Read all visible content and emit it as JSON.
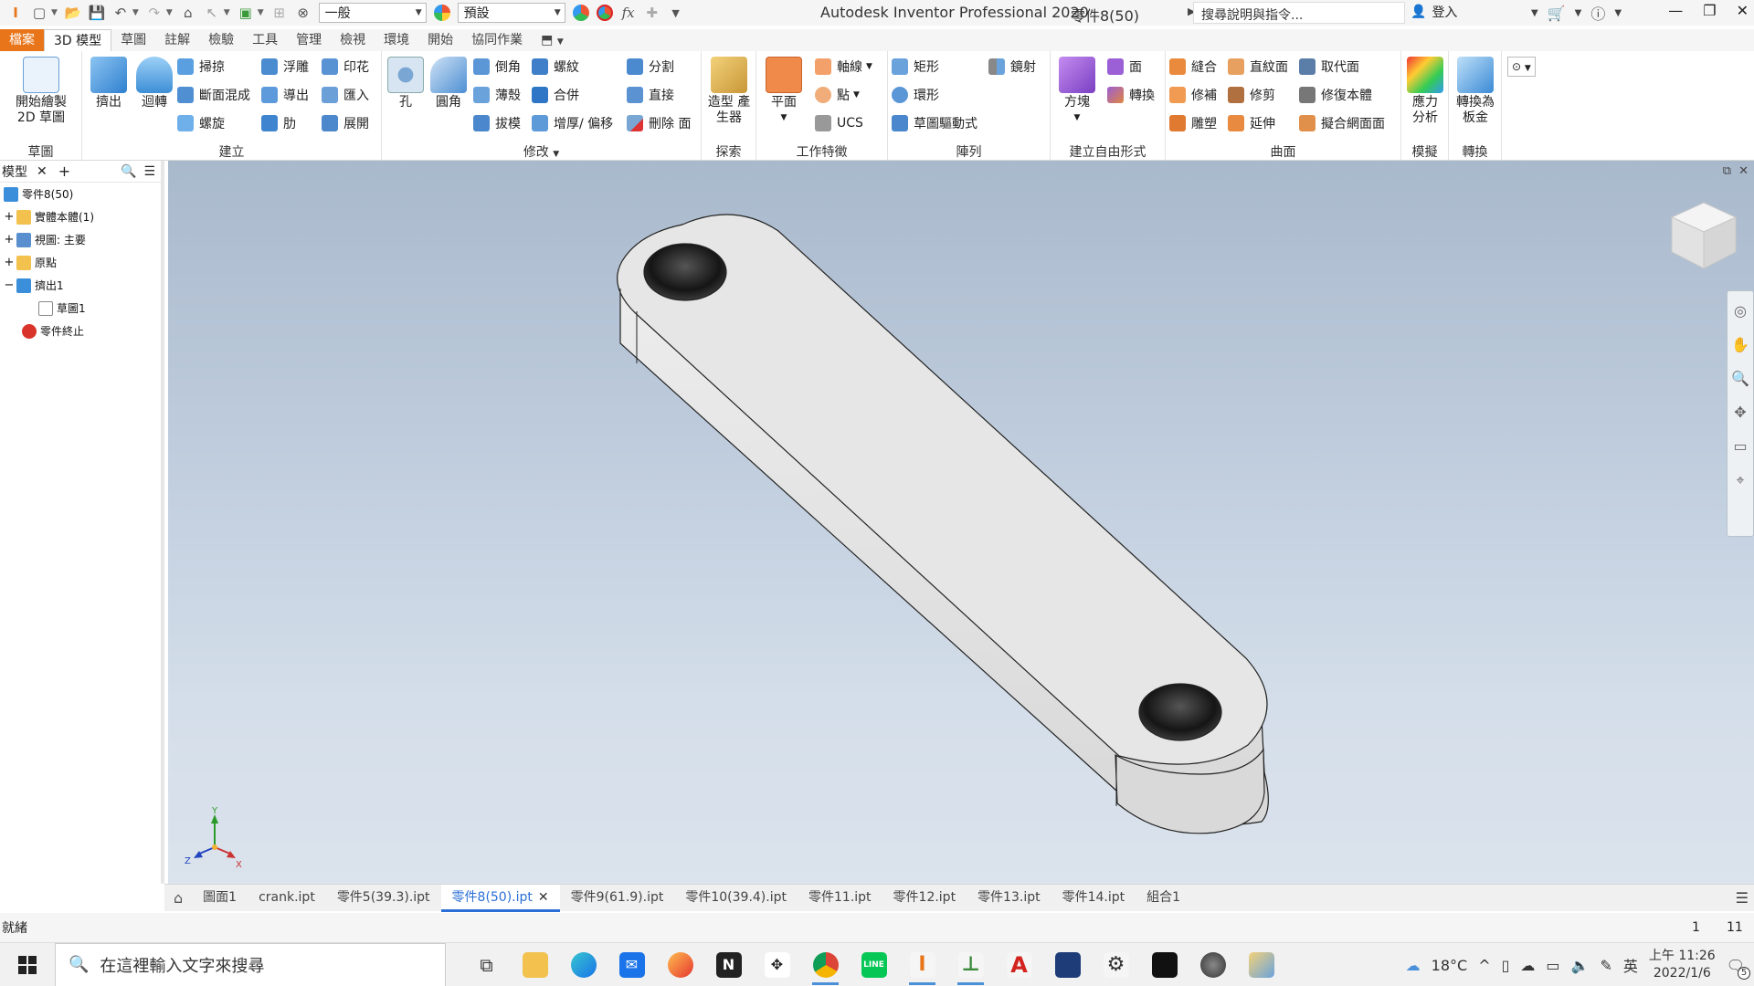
{
  "app": {
    "title": "Autodesk Inventor Professional 2020",
    "document": "零件8(50)",
    "help_search_placeholder": "搜尋說明與指令...",
    "sign_in": "登入"
  },
  "quick_access": {
    "material": "一般",
    "appearance": "預設"
  },
  "tabs": [
    "檔案",
    "3D 模型",
    "草圖",
    "註解",
    "檢驗",
    "工具",
    "管理",
    "檢視",
    "環境",
    "開始",
    "協同作業"
  ],
  "ribbon": {
    "sketch": {
      "start_2d_sketch": "開始繪製 2D 草圖",
      "panel": "草圖"
    },
    "create": {
      "extrude": "擠出",
      "revolve": "迴轉",
      "sweep": "掃掠",
      "loft": "斷面混成",
      "coil": "螺旋",
      "emboss": "浮雕",
      "derive": "導出",
      "rib": "肋",
      "decal": "印花",
      "import": "匯入",
      "unwrap": "展開",
      "panel": "建立"
    },
    "modify": {
      "hole": "孔",
      "fillet": "圓角",
      "chamfer": "倒角",
      "shell": "薄殼",
      "draft": "拔模",
      "thread": "螺紋",
      "combine": "合併",
      "thicken": "增厚/ 偏移",
      "split": "分割",
      "direct": "直接",
      "delete_face": "刪除 面",
      "panel": "修改"
    },
    "explore": {
      "shape_generator": "造型 產生器",
      "panel": "探索"
    },
    "work_features": {
      "plane": "平面",
      "axis": "軸線",
      "point": "點",
      "ucs": "UCS",
      "panel": "工作特徵"
    },
    "pattern": {
      "rectangular": "矩形",
      "circular": "環形",
      "sketch_driven": "草圖驅動式",
      "mirror": "鏡射",
      "panel": "陣列"
    },
    "freeform": {
      "box": "方塊",
      "face": "面",
      "convert": "轉換",
      "panel": "建立自由形式"
    },
    "surface": {
      "stitch": "縫合",
      "patch": "修補",
      "sculpt": "雕塑",
      "ruled_surface": "直紋面",
      "trim": "修剪",
      "extend": "延伸",
      "replace_face": "取代面",
      "repair_bodies": "修復本體",
      "fit_mesh_face": "擬合網面面",
      "panel": "曲面"
    },
    "simulation": {
      "stress_analysis": "應力 分析",
      "panel": "模擬"
    },
    "convert": {
      "to_sheet_metal": "轉換為 板金",
      "panel": "轉換"
    }
  },
  "browser": {
    "tab": "模型",
    "tree": [
      {
        "label": "零件8(50)",
        "level": 0,
        "expander": ""
      },
      {
        "label": "實體本體(1)",
        "level": 0,
        "expander": "+"
      },
      {
        "label": "視圖: 主要",
        "level": 0,
        "expander": "+"
      },
      {
        "label": "原點",
        "level": 0,
        "expander": "+"
      },
      {
        "label": "擠出1",
        "level": 0,
        "expander": "−"
      },
      {
        "label": "草圖1",
        "level": 1,
        "expander": ""
      },
      {
        "label": "零件終止",
        "level": 0,
        "expander": ""
      }
    ]
  },
  "viewport": {
    "axis_labels": {
      "x": "X",
      "y": "Y",
      "z": "Z"
    }
  },
  "document_tabs": [
    "圖面1",
    "crank.ipt",
    "零件5(39.3).ipt",
    "零件8(50).ipt",
    "零件9(61.9).ipt",
    "零件10(39.4).ipt",
    "零件11.ipt",
    "零件12.ipt",
    "零件13.ipt",
    "零件14.ipt",
    "組合1"
  ],
  "active_document_tab": "零件8(50).ipt",
  "status": {
    "text": "就緒",
    "n1": "1",
    "n2": "11"
  },
  "taskbar": {
    "search_placeholder": "在這裡輸入文字來搜尋",
    "temperature": "18°C",
    "ime": "英",
    "time": "上午 11:26",
    "date": "2022/1/6",
    "notification_count": "5"
  },
  "colors": {
    "file_tab": "#e8751a",
    "active_doc_tab": "#2b6fd6",
    "viewport_top": "#a9b9cc",
    "viewport_bottom": "#dbe3ec"
  }
}
